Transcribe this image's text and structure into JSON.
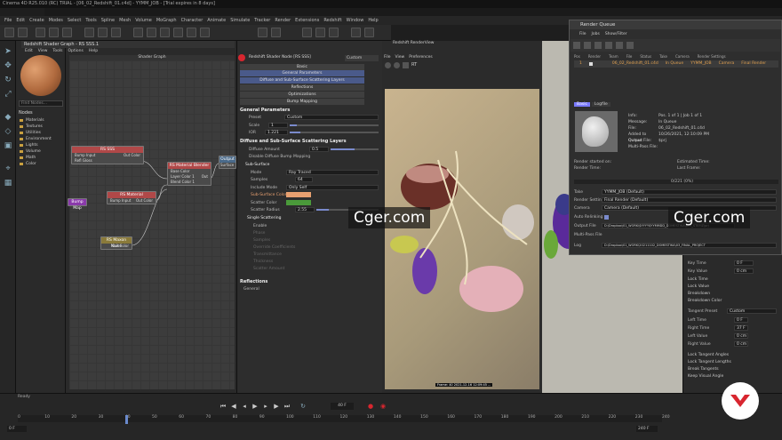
{
  "window": {
    "title": "Cinema 4D R25.010 (RC) TRIAL - [06_02_Redshift_01.c4d] - YYMM_JOB - [Trial expires in 8 days]"
  },
  "menu": [
    "File",
    "Edit",
    "Create",
    "Modes",
    "Select",
    "Tools",
    "Spline",
    "Mesh",
    "Volume",
    "MoGraph",
    "Character",
    "Animate",
    "Simulate",
    "Tracker",
    "Render",
    "Extensions",
    "Redshift",
    "Window",
    "Help"
  ],
  "shader_graph": {
    "title": "Redshift Shader Graph - RS SSS.1",
    "menu": [
      "Edit",
      "View",
      "Tools",
      "Options",
      "Help"
    ],
    "canvas_title": "Shader Graph",
    "nodes_header": "Nodes",
    "find_placeholder": "Find Nodes...",
    "node_categories": [
      "Materials",
      "Textures",
      "Utilities",
      "Environment",
      "Lights",
      "Volume",
      "Math",
      "Color"
    ],
    "nodes": [
      {
        "title": "RS SSS",
        "ports": [
          "Bump Input",
          "Refl Gloss"
        ],
        "output": "Out Color"
      },
      {
        "title": "RS Material Blender",
        "ports": [
          "Base Color",
          "Layer Color 1",
          "Blend Color 1"
        ],
        "output": "Out"
      },
      {
        "title": "RS Material",
        "ports": [
          "Bump Input"
        ],
        "output": "Out Color"
      },
      {
        "title": "RS Maxon Noise",
        "ports": [],
        "output": "Out Color"
      },
      {
        "title": "Output",
        "ports": [
          "Surface"
        ],
        "output": ""
      },
      {
        "title": "Bump Map",
        "ports": [],
        "output": ""
      }
    ]
  },
  "properties": {
    "title": "Redshift Shader Node [RS SSS]",
    "mode": "Custom",
    "tabs": [
      "Basic",
      "General Parameters",
      "Diffuse and Sub-Surface Scattering Layers",
      "Reflections",
      "Optimizations",
      "Bump Mapping"
    ],
    "general_header": "General Parameters",
    "preset_label": "Preset",
    "preset_value": "Custom",
    "scale_label": "Scale",
    "scale_value": "1",
    "ior_label": "IOR",
    "ior_value": "1.221",
    "diffuse_header": "Diffuse and Sub-Surface Scattering Layers",
    "diffuse_amount_label": "Diffuse Amount",
    "diffuse_amount_value": "0.5",
    "disable_diffuse_label": "Disable Diffuse Bump Mapping",
    "subsurface_header": "Sub-Surface",
    "mode_label": "Mode",
    "mode_value": "Ray Traced",
    "samples_label": "Samples",
    "samples_value": "64",
    "include_mode_label": "Include Mode",
    "include_mode_value": "Only Self",
    "sub_surface_color_label": "Sub-Surface Color",
    "scatter_color_label": "Scatter Color",
    "scatter_radius_label": "Scatter Radius",
    "scatter_radius_value": "2.55",
    "single_scattering_header": "Single Scattering",
    "single_items": [
      "Enable",
      "Phase",
      "Samples",
      "Override Coefficients",
      "Transmittance",
      "Thickness",
      "Scatter Amount"
    ],
    "reflections_header": "Reflections",
    "general_footer": "General",
    "sub_surface_color": "#e8a070",
    "scatter_color": "#4a9a3a"
  },
  "render_view": {
    "title": "Redshift RenderView",
    "menu": [
      "File",
      "View",
      "Preferences"
    ],
    "footer": "Frame: 40 2021-12-16 12:09:45 ..."
  },
  "render_queue": {
    "title": "Render Queue",
    "menu": [
      "File",
      "Jobs",
      "Show/Filter"
    ],
    "columns": [
      "Pos",
      "Render",
      "Team",
      "File",
      "Status",
      "Take",
      "Camera",
      "Render Settings"
    ],
    "job": {
      "pos": "1",
      "file": "06_02_Redshift_01.c4d",
      "status": "In Queue",
      "take": "YYMM_JOB",
      "camera": "Camera",
      "settings": "Final Render"
    },
    "tabs": [
      "Basic",
      "Logfile"
    ],
    "info_labels": [
      "Info:",
      "Message:",
      "File:",
      "Added to Queue:",
      "Output File:",
      "Multi-Pass File:"
    ],
    "info_values": [
      "Pos. 1 of 1 | Job 1 of 1",
      "In Queue",
      "06_02_Redshift_01.c4d",
      "10/26/2021, 12:10:09 PM",
      "$prj",
      ""
    ],
    "render_started": "Render started on:",
    "render_time": "Render Time:",
    "estimated_time": "Estimated Time:",
    "last_frame": "Last Frame:",
    "frame_counter": "0/221 (0%)",
    "take_label": "Take",
    "take_value": "YYMM_JOB (Default)",
    "settings_label": "Render Settings",
    "settings_value": "Final Render (Default)",
    "camera_label": "Camera",
    "camera_value": "Camera (Default)",
    "auto_label": "Auto Relinking",
    "output_label": "Output File",
    "output_value": "D:\\Dropbox\\01_WORK\\$YYYY$YYMMDD_DOMESTIKA\\$YY_STEFIZ\\prj",
    "multipass_label": "Multi-Pass File",
    "log_label": "Log",
    "log_value": "D:\\Dropbox\\01_WORK\\20211102_DOMESTIKA\\03_FINAL_PROJECT"
  },
  "attributes": {
    "key_time_label": "Key Time",
    "key_time_value": "0 F",
    "key_value_label": "Key Value",
    "key_value_value": "0 cm",
    "rows": [
      "Lock Time",
      "Lock Value",
      "Breakdown",
      "Breakdown Color"
    ],
    "tangent_preset_label": "Tangent Preset",
    "tangent_preset_value": "Custom",
    "left_time_label": "Left Time",
    "left_time_value": "0 F",
    "right_time_label": "Right Time",
    "right_time_value": "37 F",
    "left_value_label": "Left Value",
    "left_value_value": "0 cm",
    "right_value_label": "Right Value",
    "right_value_value": "0 cm",
    "options": [
      "Lock Tangent Angles",
      "Lock Tangent Lengths",
      "Break Tangents",
      "Keep Visual Angle"
    ]
  },
  "timeline": {
    "ruler": [
      "0",
      "10",
      "20",
      "30",
      "40",
      "50",
      "60",
      "70",
      "80",
      "90",
      "100",
      "110",
      "120",
      "130",
      "140",
      "150",
      "160",
      "170",
      "180",
      "190",
      "200",
      "210",
      "220",
      "230",
      "240"
    ],
    "current_frame": "40 F",
    "start_frame": "0 F",
    "end_frame": "240 F",
    "status": "Ready"
  },
  "watermark": "Cger.com",
  "colors": {
    "accent": "#d8262f",
    "node_header_red": "#b04848",
    "node_header_yellow": "#8a7a3a",
    "rq_tab": "#7a7aff"
  }
}
